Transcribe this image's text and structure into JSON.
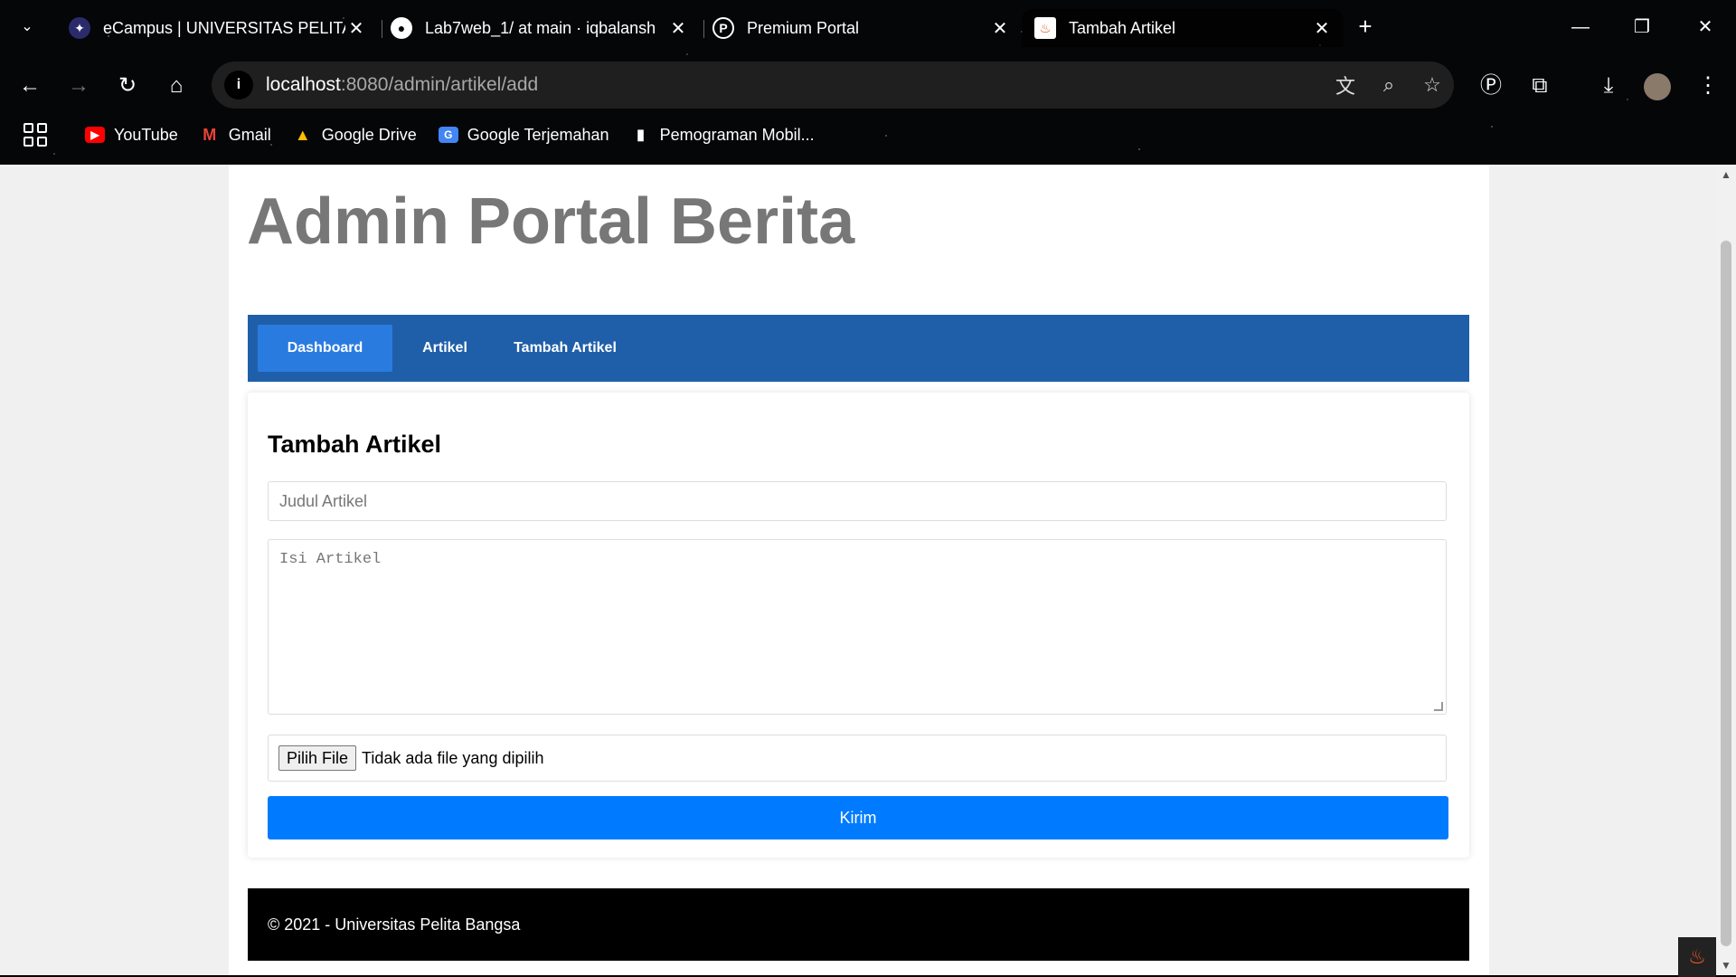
{
  "browser": {
    "tabs": [
      {
        "title": "eCampus | UNIVERSITAS PELITA",
        "icon": "campus-logo-icon"
      },
      {
        "title": "Lab7web_1/ at main · iqbalansh",
        "icon": "github-icon"
      },
      {
        "title": "Premium Portal",
        "icon": "portal-logo-icon"
      },
      {
        "title": "Tambah Artikel",
        "icon": "codeigniter-flame-icon",
        "active": true
      }
    ],
    "address": {
      "host": "localhost",
      "rest": ":8080/admin/artikel/add"
    },
    "bookmarks": [
      {
        "label": "YouTube",
        "icon": "youtube-icon",
        "color": "#ff0000"
      },
      {
        "label": "Gmail",
        "icon": "gmail-icon",
        "color": "#ea4335"
      },
      {
        "label": "Google Drive",
        "icon": "google-drive-icon",
        "color": "#1fa463"
      },
      {
        "label": "Google Terjemahan",
        "icon": "google-translate-icon",
        "color": "#4285f4"
      },
      {
        "label": "Pemograman Mobil...",
        "icon": "bookmark-page-icon",
        "color": "#ffffff"
      }
    ]
  },
  "page": {
    "site_title": "Admin Portal Berita",
    "nav": {
      "dashboard": "Dashboard",
      "artikel": "Artikel",
      "tambah": "Tambah Artikel"
    },
    "form": {
      "heading": "Tambah Artikel",
      "title_placeholder": "Judul Artikel",
      "body_placeholder": "Isi Artikel",
      "file_button": "Pilih File",
      "file_status": "Tidak ada file yang dipilih",
      "submit": "Kirim"
    },
    "footer": "© 2021 - Universitas Pelita Bangsa"
  },
  "colors": {
    "nav_bg": "#1f5fa9",
    "nav_active": "#2a7be0",
    "submit_bg": "#007bff",
    "footer_bg": "#000000"
  }
}
